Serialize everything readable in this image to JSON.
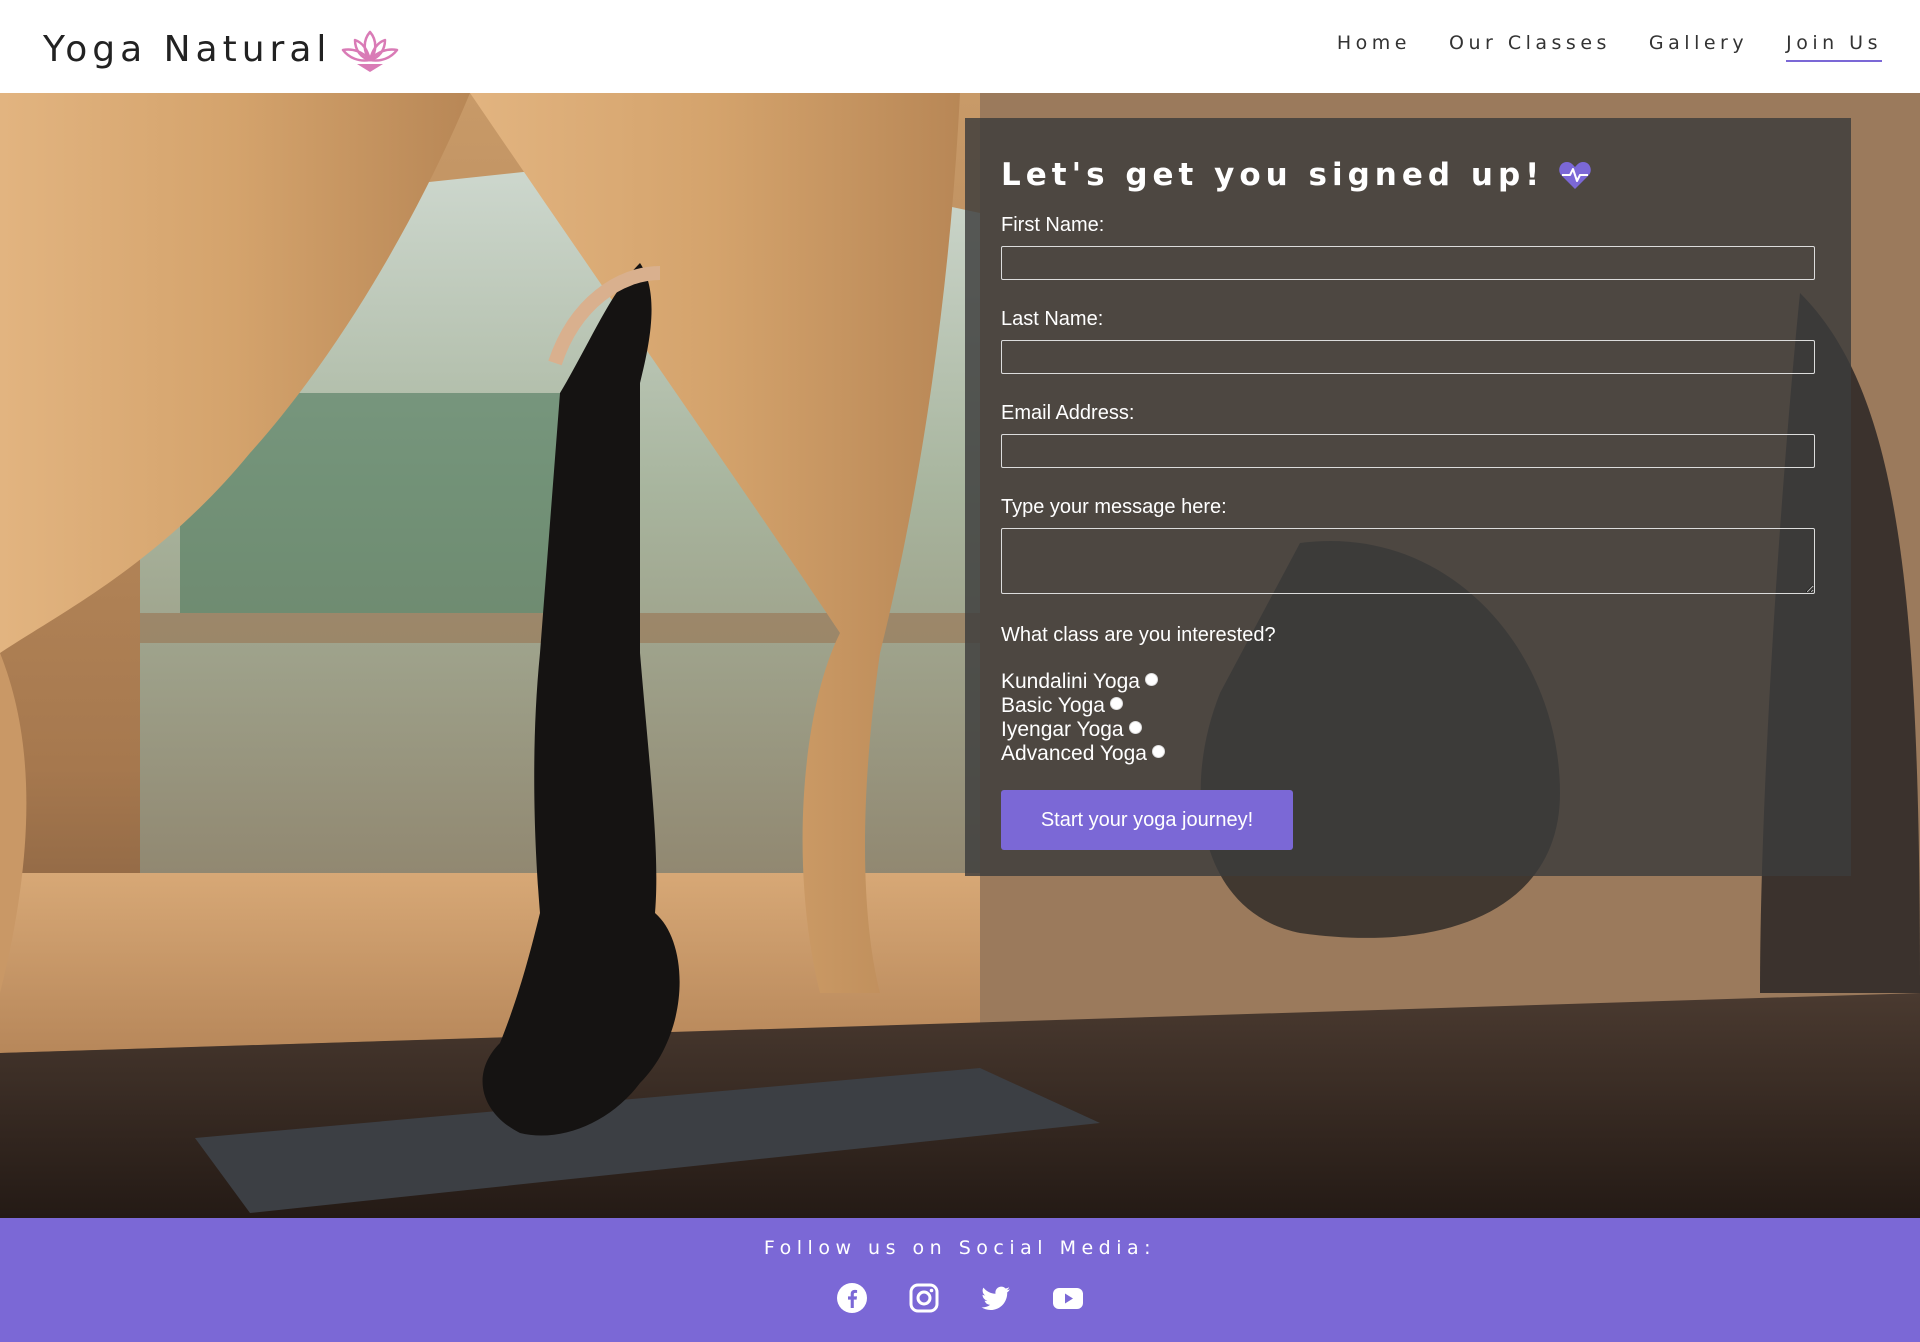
{
  "brand": {
    "name": "Yoga Natural",
    "logo_icon": "lotus-icon",
    "logo_color": "#d97bb6"
  },
  "nav": {
    "items": [
      {
        "label": "Home",
        "active": false
      },
      {
        "label": "Our Classes",
        "active": false
      },
      {
        "label": "Gallery",
        "active": false
      },
      {
        "label": "Join Us",
        "active": true
      }
    ],
    "active_underline_color": "#7b68d6"
  },
  "form": {
    "title": "Let's get you signed up!",
    "title_icon": "heartbeat-icon",
    "first_name_label": "First Name:",
    "first_name_value": "",
    "last_name_label": "Last Name:",
    "last_name_value": "",
    "email_label": "Email Address:",
    "email_value": "",
    "message_label": "Type your message here:",
    "message_value": "",
    "class_question": "What class are you interested?",
    "class_options": [
      "Kundalini Yoga",
      "Basic Yoga",
      "Iyengar Yoga",
      "Advanced Yoga"
    ],
    "submit_label": "Start your yoga journey!"
  },
  "footer": {
    "follow_text": "Follow us on Social Media:",
    "social_icons": [
      "facebook-icon",
      "instagram-icon",
      "twitter-icon",
      "youtube-icon"
    ],
    "background_color": "#7b68d6"
  },
  "colors": {
    "accent": "#7b68d6",
    "panel": "rgba(60,60,60,0.82)"
  }
}
